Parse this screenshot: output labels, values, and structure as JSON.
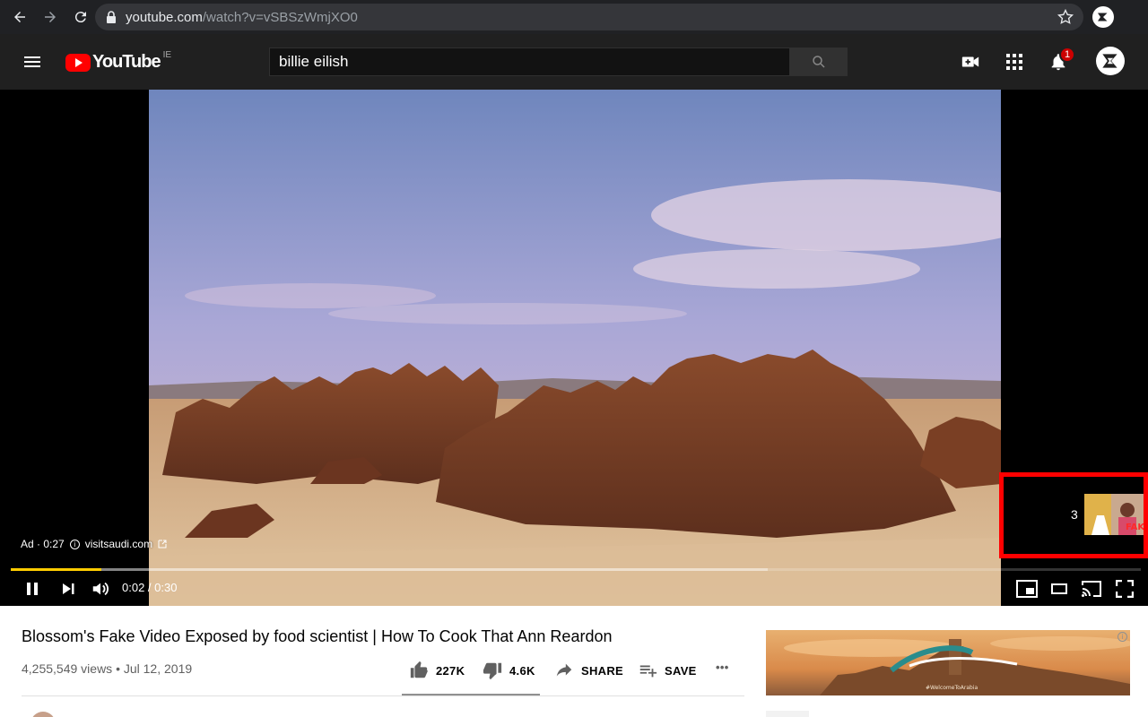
{
  "browser": {
    "url_host": "youtube.com",
    "url_path": "/watch?v=vSBSzWmjXO0",
    "icons": [
      "back-arrow-icon",
      "forward-arrow-icon",
      "reload-icon",
      "lock-icon",
      "star-icon",
      "profile-icon"
    ]
  },
  "masthead": {
    "logo_text": "YouTube",
    "country_code": "IE",
    "search_value": "billie eilish",
    "notification_count": "1",
    "icons": [
      "menu-icon",
      "search-icon",
      "create-video-icon",
      "apps-grid-icon",
      "bell-icon",
      "avatar"
    ]
  },
  "player": {
    "ad_label": "Ad · 0:27",
    "ad_link": "visitsaudi.com",
    "skip_countdown": "3",
    "current_time": "0:02",
    "duration": "0:30",
    "time_display": "0:02 / 0:30",
    "played_fraction": 0.08,
    "buffered_fraction": 0.67,
    "highlight_color": "#ff0000",
    "progress_color": "#ffcc00",
    "controls": [
      "pause-icon",
      "next-icon",
      "volume-icon",
      "miniplayer-icon",
      "theater-icon",
      "cast-icon",
      "fullscreen-icon"
    ]
  },
  "video": {
    "title": "Blossom's Fake Video Exposed by food scientist | How To Cook That Ann Reardon",
    "views": "4,255,549 views",
    "date": "Jul 12, 2019",
    "views_line": "4,255,549 views • Jul 12, 2019",
    "likes": "227K",
    "dislikes": "4.6K",
    "share_label": "SHARE",
    "save_label": "SAVE",
    "more_label": "•••"
  },
  "side_ad": {
    "caption": "#WelcomeToArabia"
  }
}
